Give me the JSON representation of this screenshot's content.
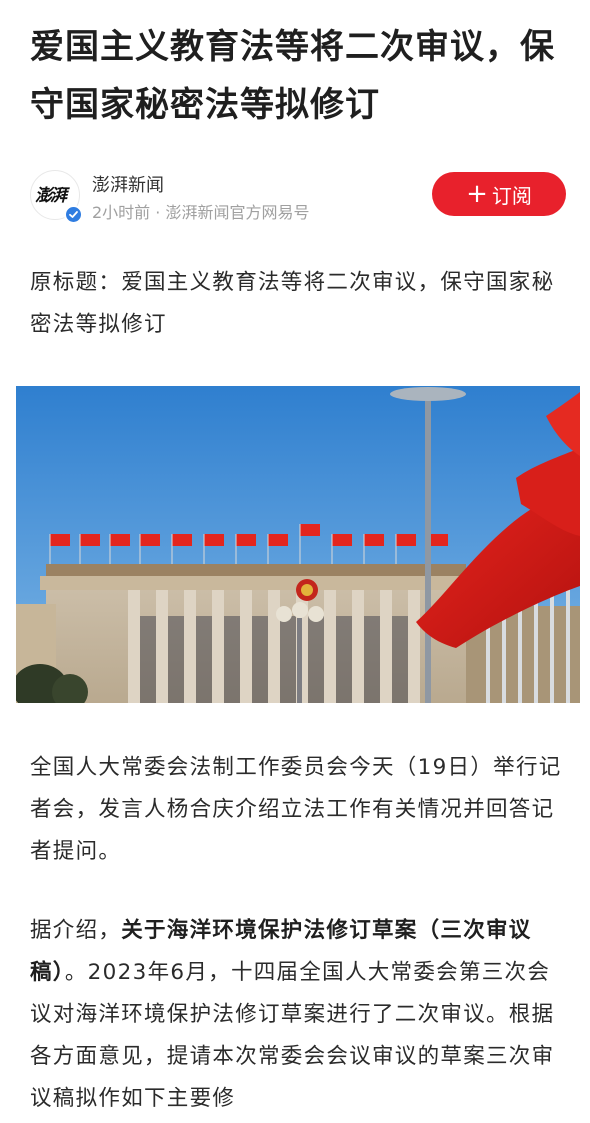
{
  "article": {
    "title": "爱国主义教育法等将二次审议，保守国家秘密法等拟修订",
    "author": {
      "name": "澎湃新闻",
      "avatar_text": "澎湃",
      "meta": "2小时前 · 澎湃新闻官方网易号",
      "verified_icon": "verified-check-icon"
    },
    "subscribe": {
      "label": "订阅",
      "icon": "plus-icon",
      "color": "#e8212c"
    },
    "original_title_paragraph": "原标题：爱国主义教育法等将二次审议，保守国家秘密法等拟修订",
    "image": {
      "subject": "great-hall-with-red-flags"
    },
    "paragraph_1": "全国人大常委会法制工作委员会今天（19日）举行记者会，发言人杨合庆介绍立法工作有关情况并回答记者提问。",
    "paragraph_2": {
      "lead": "据介绍，",
      "bold": "关于海洋环境保护法修订草案（三次审议稿）",
      "rest": "。2023年6月，十四届全国人大常委会第三次会议对海洋环境保护法修订草案进行了二次审议。根据各方面意见，提请本次常委会会议审议的草案三次审议稿拟作如下主要修"
    }
  },
  "colors": {
    "accent": "#e8212c",
    "verified": "#2f7de1",
    "meta_text": "#a0a0a0"
  }
}
